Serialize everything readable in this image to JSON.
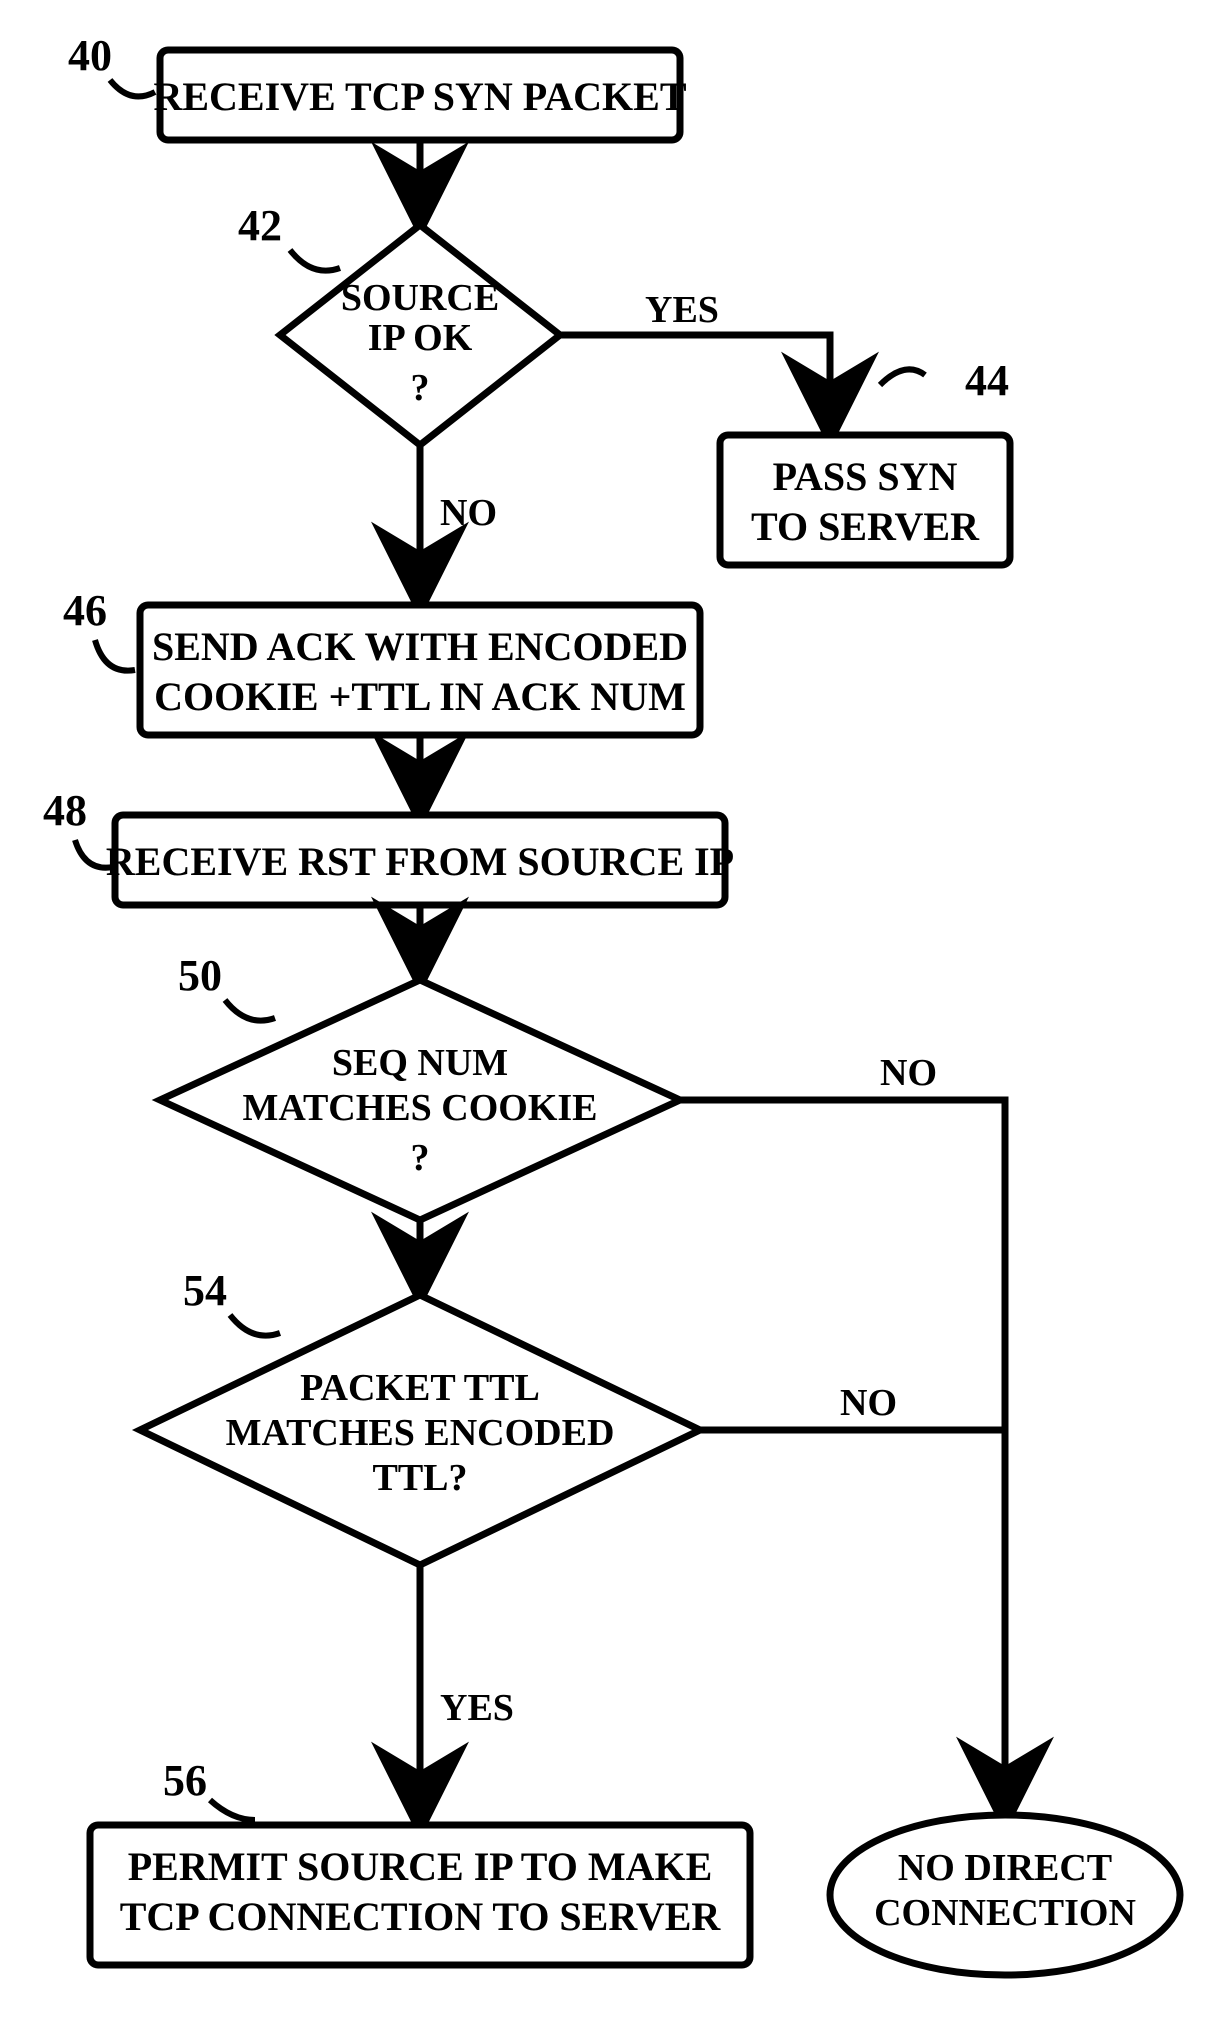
{
  "nodes": {
    "n40": {
      "ref": "40",
      "lines": [
        "RECEIVE TCP SYN PACKET"
      ]
    },
    "n42": {
      "ref": "42",
      "lines": [
        "SOURCE",
        "IP OK",
        "?"
      ]
    },
    "n44": {
      "ref": "44",
      "lines": [
        "PASS SYN",
        "TO SERVER"
      ]
    },
    "n46": {
      "ref": "46",
      "lines": [
        "SEND ACK WITH ENCODED",
        "COOKIE +TTL IN ACK NUM"
      ]
    },
    "n48": {
      "ref": "48",
      "lines": [
        "RECEIVE RST FROM SOURCE IP"
      ]
    },
    "n50": {
      "ref": "50",
      "lines": [
        "SEQ NUM",
        "MATCHES COOKIE",
        "?"
      ]
    },
    "n54": {
      "ref": "54",
      "lines": [
        "PACKET TTL",
        "MATCHES ENCODED",
        "TTL?"
      ]
    },
    "n56": {
      "ref": "56",
      "lines": [
        "PERMIT SOURCE IP TO MAKE",
        "TCP CONNECTION TO SERVER"
      ]
    },
    "nd": {
      "lines": [
        "NO DIRECT",
        "CONNECTION"
      ]
    }
  },
  "edges": {
    "e42_yes": "YES",
    "e42_no": "NO",
    "e50_no": "NO",
    "e54_no": "NO",
    "e54_yes": "YES"
  }
}
